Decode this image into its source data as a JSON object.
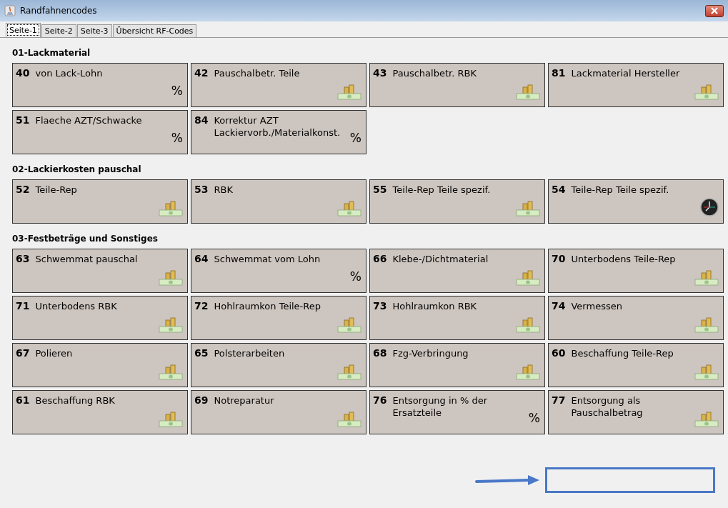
{
  "window": {
    "title": "Randfahnencodes"
  },
  "tabs": [
    {
      "label": "Seite-1",
      "selected": true
    },
    {
      "label": "Seite-2",
      "selected": false
    },
    {
      "label": "Seite-3",
      "selected": false
    },
    {
      "label": "Übersicht RF-Codes",
      "selected": false
    }
  ],
  "sections": [
    {
      "title": "01-Lackmaterial",
      "cards": [
        {
          "code": "40",
          "label": "von Lack-Lohn",
          "kind": "percent",
          "symbol": "%"
        },
        {
          "code": "42",
          "label": "Pauschalbetr. Teile",
          "kind": "money"
        },
        {
          "code": "43",
          "label": "Pauschalbetr. RBK",
          "kind": "money"
        },
        {
          "code": "81",
          "label": "Lackmaterial Hersteller",
          "kind": "money"
        },
        {
          "code": "51",
          "label": "Flaeche AZT/Schwacke",
          "kind": "percent",
          "symbol": "%"
        },
        {
          "code": "84",
          "label": "Korrektur AZT Lackiervorb./Materialkonst.",
          "kind": "percent",
          "symbol": "%"
        }
      ]
    },
    {
      "title": "02-Lackierkosten pauschal",
      "cards": [
        {
          "code": "52",
          "label": "Teile-Rep",
          "kind": "money"
        },
        {
          "code": "53",
          "label": "RBK",
          "kind": "money"
        },
        {
          "code": "55",
          "label": "Teile-Rep Teile spezif.",
          "kind": "money"
        },
        {
          "code": "54",
          "label": "Teile-Rep Teile spezif.",
          "kind": "clock"
        }
      ]
    },
    {
      "title": "03-Festbeträge und Sonstiges",
      "cards": [
        {
          "code": "63",
          "label": "Schwemmat pauschal",
          "kind": "money"
        },
        {
          "code": "64",
          "label": "Schwemmat vom Lohn",
          "kind": "percent",
          "symbol": "%"
        },
        {
          "code": "66",
          "label": "Klebe-/Dichtmaterial",
          "kind": "money"
        },
        {
          "code": "70",
          "label": "Unterbodens Teile-Rep",
          "kind": "money"
        },
        {
          "code": "71",
          "label": "Unterbodens RBK",
          "kind": "money"
        },
        {
          "code": "72",
          "label": "Hohlraumkon Teile-Rep",
          "kind": "money"
        },
        {
          "code": "73",
          "label": "Hohlraumkon RBK",
          "kind": "money"
        },
        {
          "code": "74",
          "label": "Vermessen",
          "kind": "money"
        },
        {
          "code": "67",
          "label": "Polieren",
          "kind": "money"
        },
        {
          "code": "65",
          "label": "Polsterarbeiten",
          "kind": "money"
        },
        {
          "code": "68",
          "label": "Fzg-Verbringung",
          "kind": "money"
        },
        {
          "code": "60",
          "label": "Beschaffung Teile-Rep",
          "kind": "money"
        },
        {
          "code": "61",
          "label": "Beschaffung RBK",
          "kind": "money"
        },
        {
          "code": "69",
          "label": "Notreparatur",
          "kind": "money"
        },
        {
          "code": "76",
          "label": "Entsorgung in % der Ersatzteile",
          "kind": "percent",
          "symbol": "%"
        },
        {
          "code": "77",
          "label": "Entsorgung als Pauschalbetrag",
          "kind": "money"
        }
      ]
    }
  ]
}
